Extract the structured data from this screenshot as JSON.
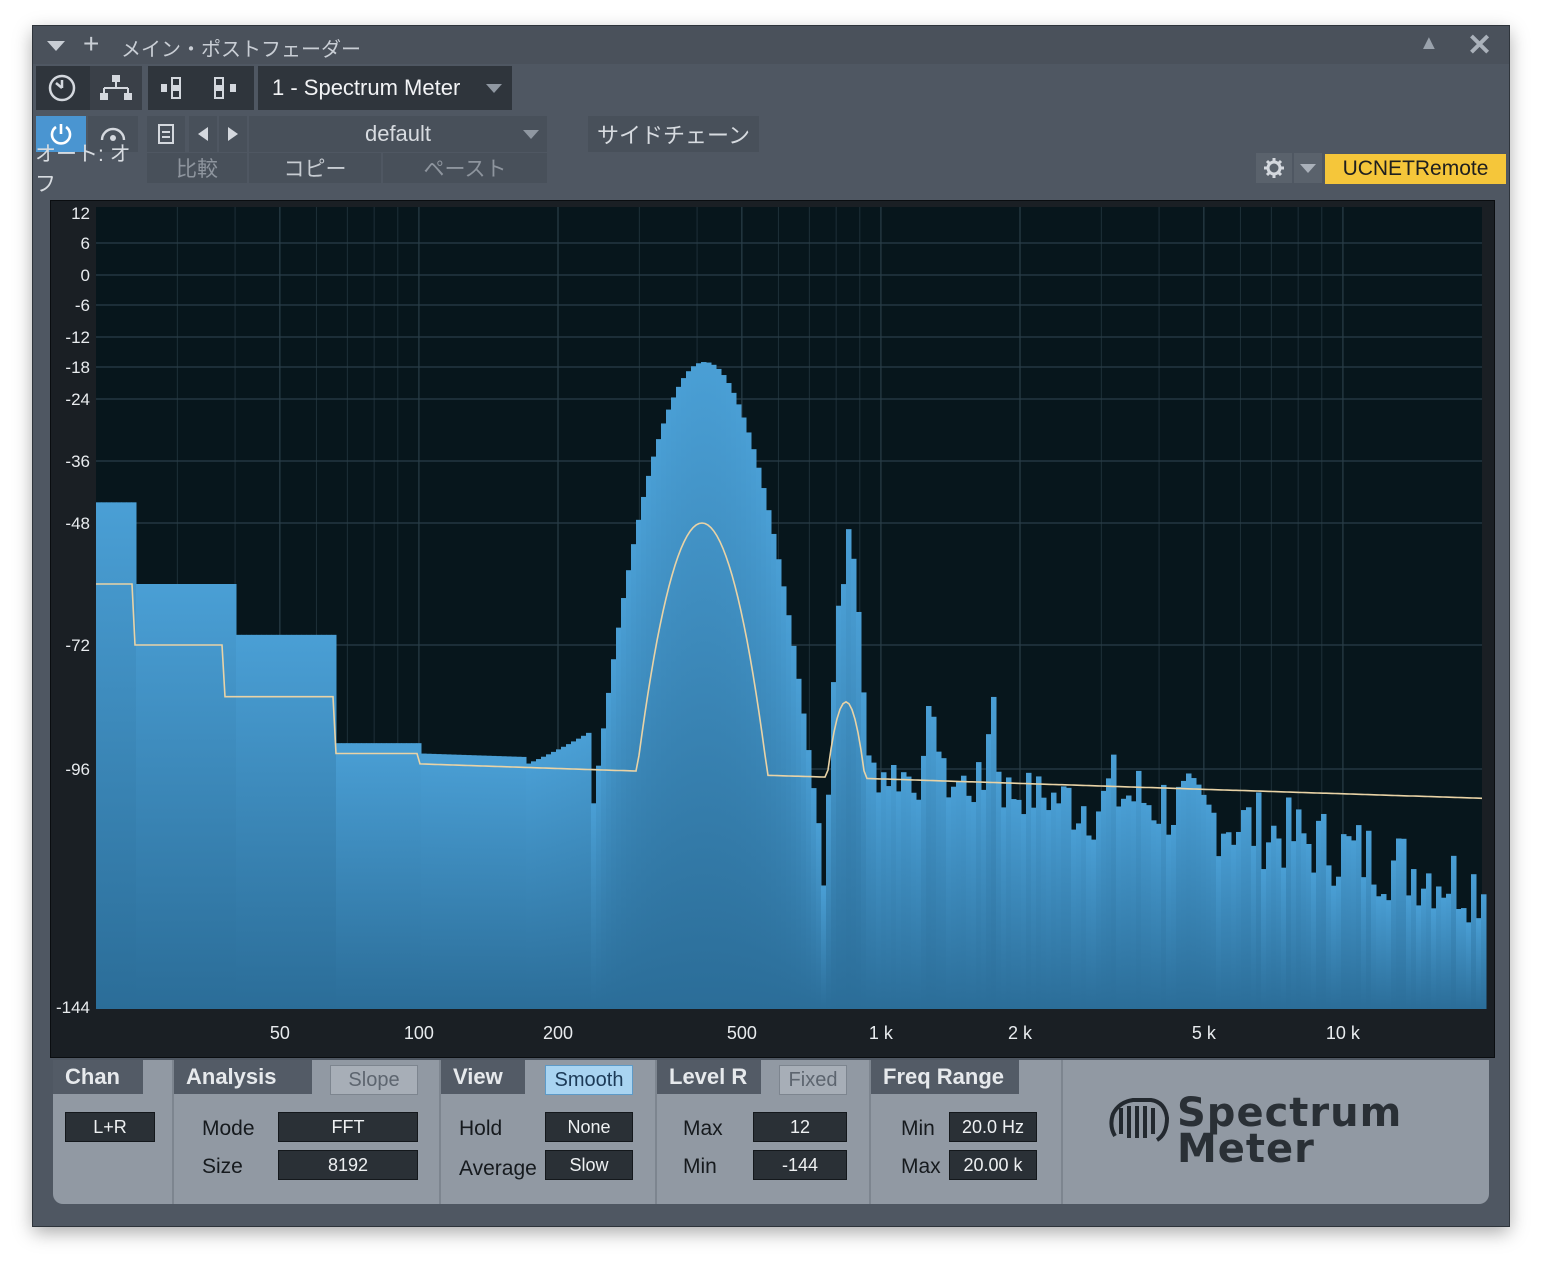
{
  "window": {
    "title": "メイン・ポストフェーダー",
    "pin_icon": "pin-icon",
    "close_icon": "close-icon"
  },
  "toolbar": {
    "preset_name": "1 - Spectrum Meter",
    "preset_file": "default",
    "sidechain": "サイドチェーン",
    "auto_label": "オート: オフ",
    "compare": "比較",
    "copy": "コピー",
    "paste": "ペースト",
    "remote": "UCNETRemote"
  },
  "plot": {
    "y_ticks": [
      "12",
      "6",
      "0",
      "-6",
      "-12",
      "-18",
      "-24",
      "-36",
      "-48",
      "-72",
      "-96",
      "-144"
    ],
    "x_ticks": [
      "50",
      "100",
      "200",
      "500",
      "1 k",
      "2 k",
      "5 k",
      "10 k"
    ]
  },
  "panels": {
    "chan": {
      "title": "Chan",
      "value": "L+R"
    },
    "analysis": {
      "title": "Analysis",
      "slope": "Slope",
      "mode_label": "Mode",
      "mode": "FFT",
      "size_label": "Size",
      "size": "8192"
    },
    "view": {
      "title": "View",
      "smooth": "Smooth",
      "hold_label": "Hold",
      "hold": "None",
      "avg_label": "Average",
      "avg": "Slow"
    },
    "level": {
      "title": "Level R",
      "fixed": "Fixed",
      "max_label": "Max",
      "max": "12",
      "min_label": "Min",
      "min": "-144"
    },
    "freq": {
      "title": "Freq Range",
      "min_label": "Min",
      "min": "20.0 Hz",
      "max_label": "Max",
      "max": "20.00 k"
    }
  },
  "logo": {
    "line1": "Spectrum",
    "line2": "Meter"
  },
  "colors": {
    "accent_yellow": "#f5c63a",
    "spectrum_fill": "#3f8dbf",
    "avg_line": "#e9d3a6",
    "plot_bg": "#07161c"
  }
}
